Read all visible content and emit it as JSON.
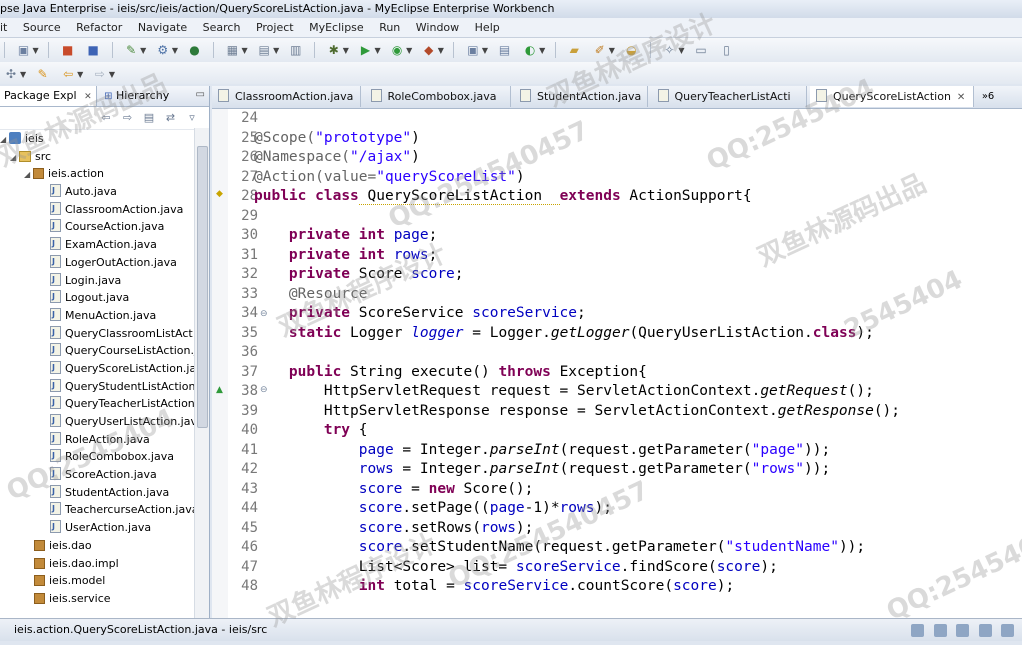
{
  "window": {
    "title": "pse Java Enterprise - ieis/src/ieis/action/QueryScoreListAction.java - MyEclipse Enterprise Workbench"
  },
  "menubar": [
    "it",
    "Source",
    "Refactor",
    "Navigate",
    "Search",
    "Project",
    "MyEclipse",
    "Run",
    "Window",
    "Help"
  ],
  "explorer": {
    "tabs": {
      "package": "Package Expl",
      "hierarchy": "Hierarchy"
    },
    "tree": {
      "project": "ieis",
      "src": "src",
      "package_action": "ieis.action",
      "files": [
        "Auto.java",
        "ClassroomAction.java",
        "CourseAction.java",
        "ExamAction.java",
        "LogerOutAction.java",
        "Login.java",
        "Logout.java",
        "MenuAction.java",
        "QueryClassroomListAct",
        "QueryCourseListAction.j",
        "QueryScoreListAction.jav",
        "QueryStudentListAction.j",
        "QueryTeacherListAction.j",
        "QueryUserListAction.java",
        "RoleAction.java",
        "RoleCombobox.java",
        "ScoreAction.java",
        "StudentAction.java",
        "TeachercurseAction.java",
        "UserAction.java"
      ],
      "packages": [
        "ieis.dao",
        "ieis.dao.impl",
        "ieis.model",
        "ieis.service"
      ]
    }
  },
  "editor": {
    "tabs": [
      "ClassroomAction.java",
      "RoleCombobox.java",
      "StudentAction.java",
      "QueryTeacherListActi",
      "QueryScoreListAction"
    ],
    "more_tabs": "»6",
    "line_numbers": [
      "24",
      "25",
      "26",
      "27",
      "28",
      "29",
      "30",
      "31",
      "32",
      "33",
      "34",
      "35",
      "36",
      "37",
      "38",
      "39",
      "40",
      "41",
      "42",
      "43",
      "44",
      "45",
      "46",
      "47",
      "48"
    ]
  },
  "code": {
    "l25": [
      "@Scope(",
      "\"prototype\"",
      ")"
    ],
    "l26": [
      "@Namespace(",
      "\"/ajax\"",
      ")"
    ],
    "l27": [
      "@Action(value=",
      "\"queryScoreList\"",
      ")"
    ],
    "l28": [
      "public",
      " ",
      "class",
      " QueryScoreListAction  ",
      "extends",
      " ActionSupport{"
    ],
    "l30": [
      "    ",
      "private",
      " ",
      "int",
      " ",
      "page",
      ";"
    ],
    "l31": [
      "    ",
      "private",
      " ",
      "int",
      " ",
      "rows",
      ";"
    ],
    "l32": [
      "    ",
      "private",
      " Score ",
      "score",
      ";"
    ],
    "l33": [
      "    ",
      "@Resource"
    ],
    "l34": [
      "    ",
      "private",
      " ScoreService ",
      "scoreService",
      ";"
    ],
    "l35": [
      "    ",
      "static",
      " Logger ",
      "logger",
      " = Logger.",
      "getLogger",
      "(QueryUserListAction.",
      "class",
      ");"
    ],
    "l37": [
      "    ",
      "public",
      " String execute() ",
      "throws",
      " Exception{"
    ],
    "l38": [
      "        HttpServletRequest request = ServletActionContext.",
      "getRequest",
      "();"
    ],
    "l39": [
      "        HttpServletResponse response = ServletActionContext.",
      "getResponse",
      "();"
    ],
    "l40": [
      "        ",
      "try",
      " {"
    ],
    "l41": [
      "            ",
      "page",
      " = Integer.",
      "parseInt",
      "(request.getParameter(",
      "\"page\"",
      "));"
    ],
    "l42": [
      "            ",
      "rows",
      " = Integer.",
      "parseInt",
      "(request.getParameter(",
      "\"rows\"",
      "));"
    ],
    "l43": [
      "            ",
      "score",
      " = ",
      "new",
      " Score();"
    ],
    "l44": [
      "            ",
      "score",
      ".setPage((",
      "page",
      "-1)*",
      "rows",
      ");"
    ],
    "l45": [
      "            ",
      "score",
      ".setRows(",
      "rows",
      ");"
    ],
    "l46": [
      "            ",
      "score",
      ".setStudentName(request.getParameter(",
      "\"studentName\"",
      "));"
    ],
    "l47": [
      "            List<Score> list= ",
      "scoreService",
      ".findScore(",
      "score",
      ");"
    ],
    "l48": [
      "            ",
      "int",
      " total = ",
      "scoreService",
      ".countScore(",
      "score",
      ");"
    ]
  },
  "statusbar": {
    "text": "ieis.action.QueryScoreListAction.java - ieis/src"
  },
  "watermarks": [
    "QQ:2545404",
    "双鱼林源码出品",
    "双鱼林程序设计",
    "QQ:254540457",
    "2545404",
    "双鱼林源码出品",
    "双鱼林程序设计",
    "QQ:2545404",
    "QQ:254540457",
    "双鱼林程序设计",
    "QQ:2545404"
  ],
  "colors": {
    "keyword": "#7f0055",
    "string": "#2a00ff",
    "field": "#0000c0",
    "annotation": "#646464"
  }
}
